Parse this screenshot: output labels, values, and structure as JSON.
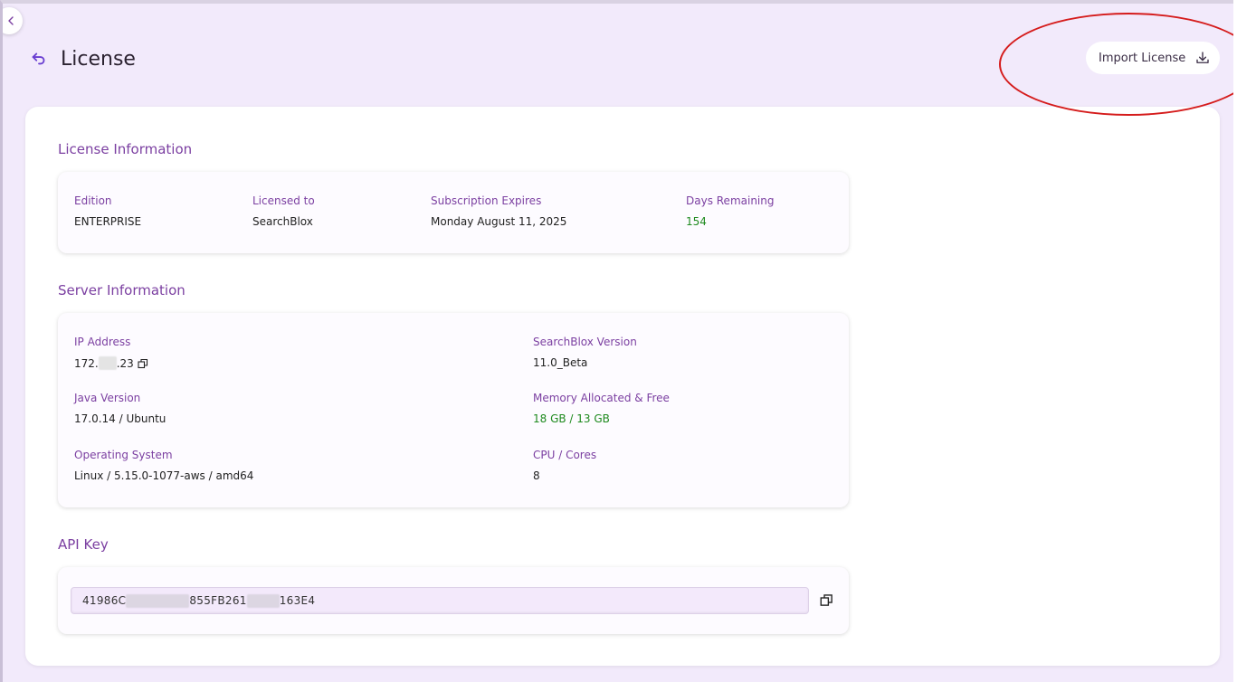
{
  "header": {
    "title": "License",
    "import_button_label": "Import License"
  },
  "license": {
    "section_title": "License Information",
    "fields": [
      {
        "label": "Edition",
        "value": "ENTERPRISE"
      },
      {
        "label": "Licensed to",
        "value": "SearchBlox"
      },
      {
        "label": "Subscription Expires",
        "value": "Monday August 11, 2025"
      },
      {
        "label": "Days Remaining",
        "value": "154"
      }
    ]
  },
  "server": {
    "section_title": "Server Information",
    "ip_address": {
      "label": "IP Address",
      "value_start": "172.",
      "value_end": ".23"
    },
    "searchblox_version": {
      "label": "SearchBlox Version",
      "value": "11.0_Beta"
    },
    "java_version": {
      "label": "Java Version",
      "value": "17.0.14 / Ubuntu"
    },
    "memory": {
      "label": "Memory Allocated & Free",
      "value": "18 GB / 13 GB"
    },
    "os": {
      "label": "Operating System",
      "value": "Linux / 5.15.0-1077-aws / amd64"
    },
    "cpu": {
      "label": "CPU / Cores",
      "value": "8"
    }
  },
  "api_key": {
    "section_title": "API Key",
    "part1": "41986C",
    "part2": "855FB261",
    "part3": "163E4"
  },
  "colors": {
    "accent": "#7b3fa1",
    "background": "#f2eafb",
    "positive": "#1e8a1e",
    "highlight": "#d51c1c"
  }
}
